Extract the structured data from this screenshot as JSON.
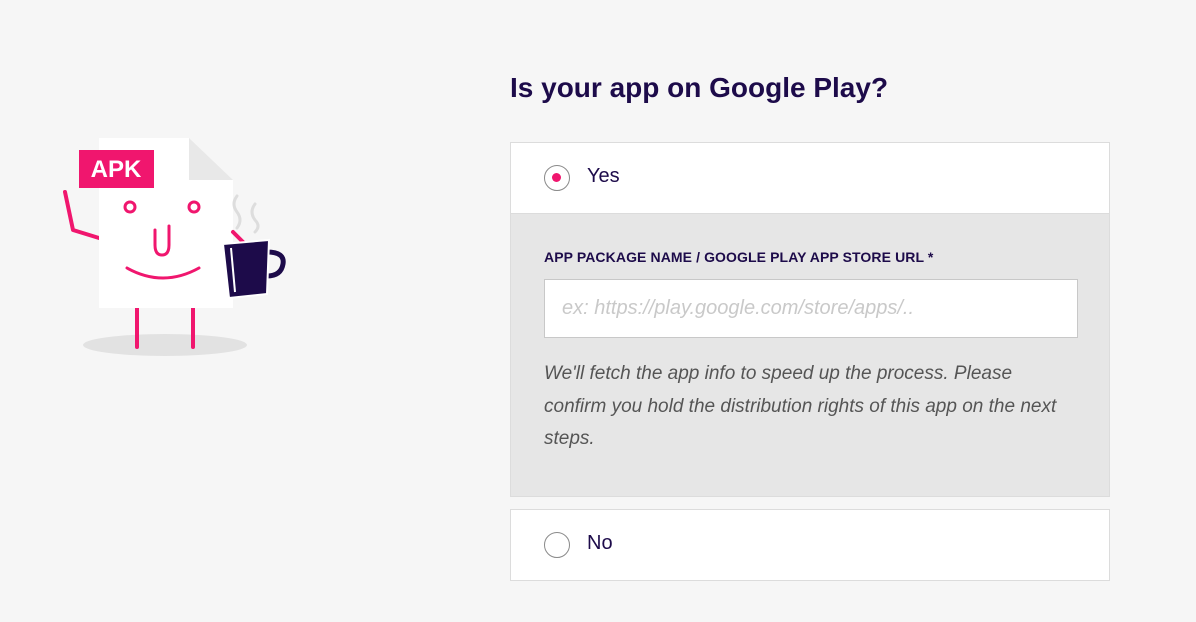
{
  "illustration": {
    "badge_text": "APK"
  },
  "question": {
    "title": "Is your app on Google Play?"
  },
  "options": {
    "yes": {
      "label": "Yes",
      "selected": true
    },
    "no": {
      "label": "No",
      "selected": false
    }
  },
  "package_field": {
    "label": "APP PACKAGE NAME / GOOGLE PLAY APP STORE URL *",
    "value": "",
    "placeholder": "ex: https://play.google.com/store/apps/..",
    "help": "We'll fetch the app info to speed up the process. Please confirm you hold the distribution rights of this app on the next steps."
  },
  "colors": {
    "accent": "#f0166e",
    "title": "#1d0b4a",
    "background": "#f6f6f6",
    "panel": "#e6e6e6",
    "mug": "#1d0b4a"
  }
}
